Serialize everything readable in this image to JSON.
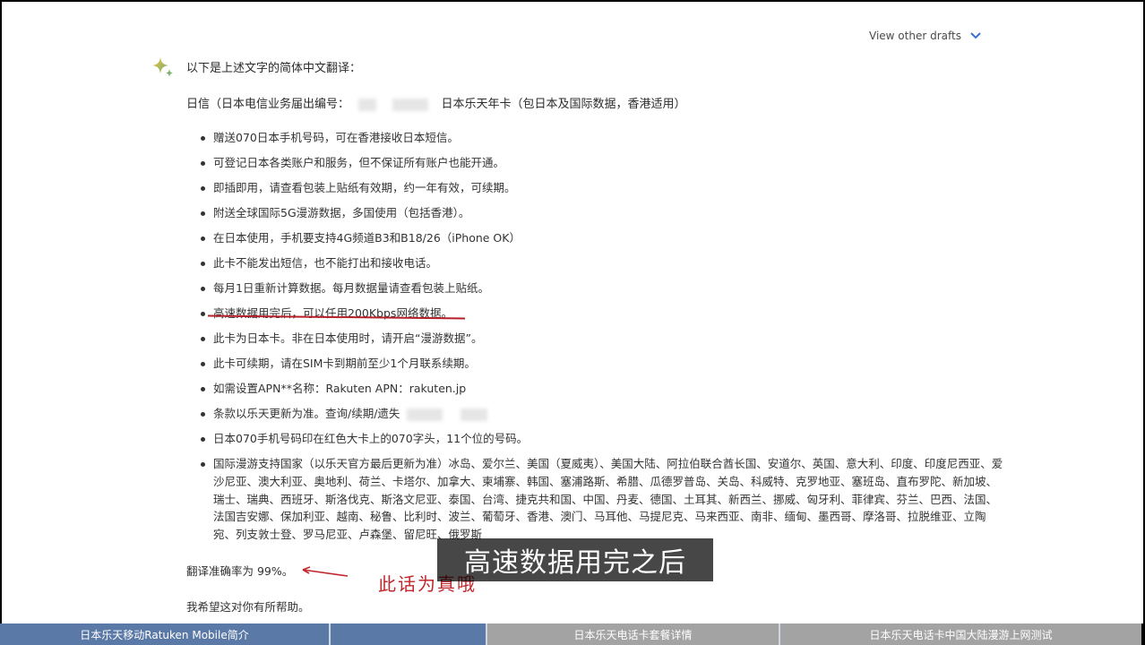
{
  "header": {
    "view_drafts": "View other drafts"
  },
  "response": {
    "intro": "以下是上述文字的简体中文翻译：",
    "title_prefix": "日信（日本电信业务届出编号：",
    "title_suffix": "日本乐天年卡（包日本及国际数据，香港适用）",
    "bullets": [
      "赠送070日本手机号码，可在香港接收日本短信。",
      "可登记日本各类账户和服务，但不保证所有账户也能开通。",
      "即插即用，请查看包装上贴纸有效期，约一年有效，可续期。",
      "附送全球国际5G漫游数据，多国使用（包括香港）。",
      "在日本使用，手机要支持4G频道B3和B18/26（iPhone OK）",
      "此卡不能发出短信，也不能打出和接收电话。",
      "每月1日重新计算数据。每月数据量请查看包装上贴纸。",
      "高速数据用完后，可以任用200Kbps网络数据。",
      "此卡为日本卡。非在日本使用时，请开启“漫游数据”。",
      "此卡可续期，请在SIM卡到期前至少1个月联系续期。",
      "如需设置APN**名称：Rakuten APN：rakuten.jp",
      "条款以乐天更新为准。查询/续期/遗失",
      "日本070手机号码印在红色大卡上的070字头，11个位的号码。",
      "国际漫游支持国家（以乐天官方最后更新为准）冰岛、爱尔兰、美国（夏威夷）、美国大陆、阿拉伯联合酋长国、安道尔、英国、意大利、印度、印度尼西亚、爱沙尼亚、澳大利亚、奥地利、荷兰、卡塔尔、加拿大、柬埔寨、韩国、塞浦路斯、希腊、瓜德罗普岛、关岛、科威特、克罗地亚、塞班岛、直布罗陀、新加坡、瑞士、瑞典、西班牙、斯洛伐克、斯洛文尼亚、泰国、台湾、捷克共和国、中国、丹麦、德国、土耳其、新西兰、挪威、匈牙利、菲律宾、芬兰、巴西、法国、法国吉安娜、保加利亚、越南、秘鲁、比利时、波兰、葡萄牙、香港、澳门、马耳他、马提尼克、马来西亚、南非、缅甸、墨西哥、摩洛哥、拉脱维亚、立陶宛、列支敦士登、罗马尼亚、卢森堡、留尼旺、俄罗斯"
    ],
    "accuracy": "翻译准确率为 99%。",
    "closing": "我希望这对你有所帮助。"
  },
  "annotation": {
    "note": "此话为真哦",
    "color": "#c0272d"
  },
  "caption": {
    "text": "高速数据用完之后"
  },
  "tabs": [
    {
      "label": "日本乐天移动Ratuken Mobile简介"
    },
    {
      "label": ""
    },
    {
      "label": "日本乐天电话卡套餐详情"
    },
    {
      "label": "日本乐天电话卡中国大陆漫游上网测试"
    }
  ]
}
